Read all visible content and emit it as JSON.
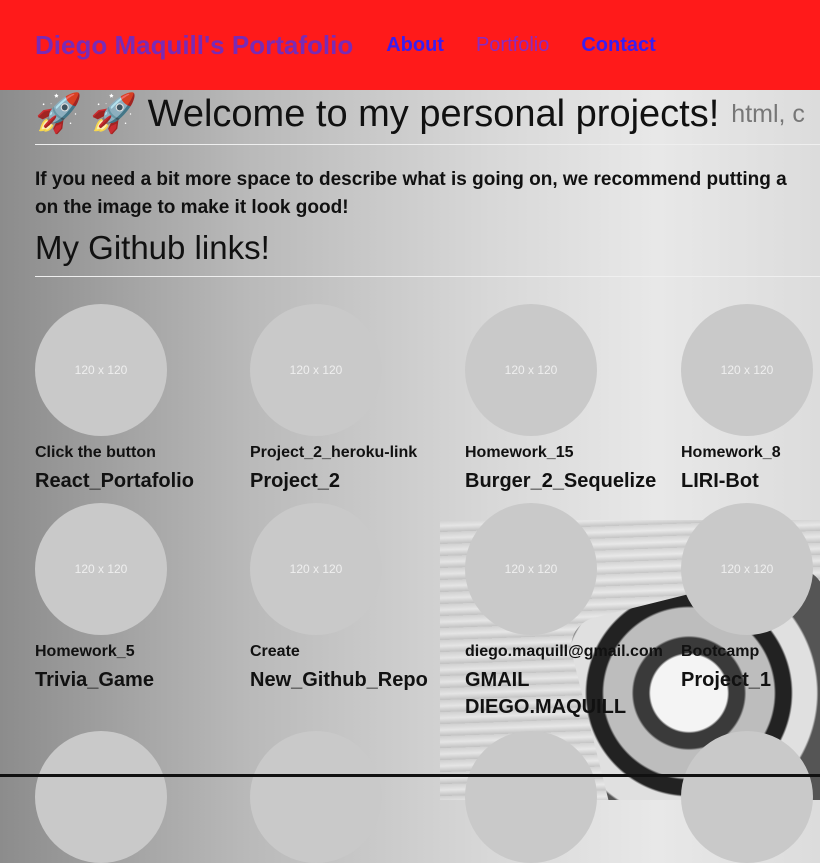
{
  "nav": {
    "brand": "Diego Maquill's Portafolio",
    "links": [
      "About",
      "Portfolio",
      "Contact"
    ]
  },
  "header": {
    "rocket_1": "🚀",
    "rocket_2": "🚀",
    "title": "Welcome to my personal projects!",
    "subtitle": "html, c"
  },
  "intro": "If you need a bit more space to describe what is going on, we recommend putting a on the image to make it look good!",
  "intro_lines": [
    "If you need a bit more space to describe what is going on, we recommend putting a",
    "on the image to make it look good!"
  ],
  "section_title": "My Github links!",
  "placeholder_text": "120 x 120",
  "cards": [
    {
      "small": "Click the button",
      "big": "React_Portafolio"
    },
    {
      "small": "Project_2_heroku-link",
      "big": "Project_2"
    },
    {
      "small": "Homework_15",
      "big": "Burger_2_Sequelize"
    },
    {
      "small": "Homework_8",
      "big": "LIRI-Bot"
    },
    {
      "small": "Homework_5",
      "big": "Trivia_Game"
    },
    {
      "small": "Create",
      "big": "New_Github_Repo"
    },
    {
      "small": "diego.maquill@gmail.com",
      "big": "GMAIL DIEGO.MAQUILL"
    },
    {
      "small": "Bootcamp",
      "big": "Project_1"
    }
  ]
}
